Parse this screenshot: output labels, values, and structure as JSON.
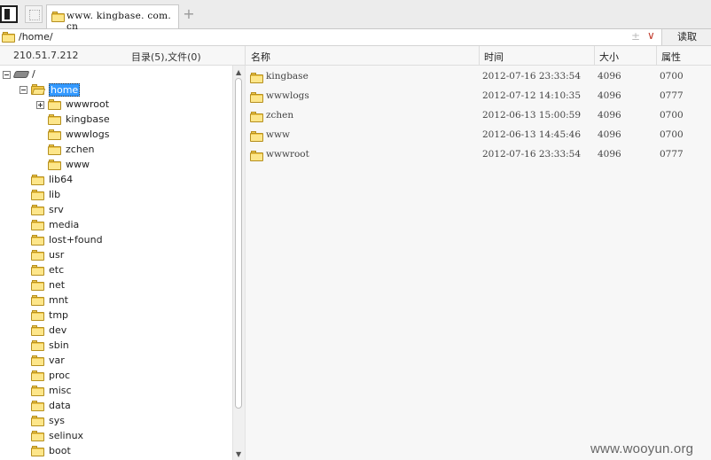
{
  "tabs": [
    {
      "title": "www. kingbase. com. cn"
    }
  ],
  "address": {
    "path": "/home/",
    "read_button": "读取"
  },
  "info": {
    "ip": "210.51.7.212",
    "counts": "目录(5),文件(0)"
  },
  "columns": {
    "name": "名称",
    "time": "时间",
    "size": "大小",
    "perm": "属性"
  },
  "tree": [
    {
      "label": "/",
      "icon": "drive-icon",
      "expander": "minus"
    },
    {
      "label": "home",
      "icon": "folder-open-icon",
      "expander": "minus",
      "selected": true
    },
    {
      "label": "wwwroot",
      "icon": "folder-icon",
      "expander": "plus"
    },
    {
      "label": "kingbase",
      "icon": "folder-icon"
    },
    {
      "label": "wwwlogs",
      "icon": "folder-icon"
    },
    {
      "label": "zchen",
      "icon": "folder-icon"
    },
    {
      "label": "www",
      "icon": "folder-icon"
    },
    {
      "label": "lib64",
      "icon": "folder-icon"
    },
    {
      "label": "lib",
      "icon": "folder-icon"
    },
    {
      "label": "srv",
      "icon": "folder-icon"
    },
    {
      "label": "media",
      "icon": "folder-icon"
    },
    {
      "label": "lost+found",
      "icon": "folder-icon"
    },
    {
      "label": "usr",
      "icon": "folder-icon"
    },
    {
      "label": "etc",
      "icon": "folder-icon"
    },
    {
      "label": "net",
      "icon": "folder-icon"
    },
    {
      "label": "mnt",
      "icon": "folder-icon"
    },
    {
      "label": "tmp",
      "icon": "folder-icon"
    },
    {
      "label": "dev",
      "icon": "folder-icon"
    },
    {
      "label": "sbin",
      "icon": "folder-icon"
    },
    {
      "label": "var",
      "icon": "folder-icon"
    },
    {
      "label": "proc",
      "icon": "folder-icon"
    },
    {
      "label": "misc",
      "icon": "folder-icon"
    },
    {
      "label": "data",
      "icon": "folder-icon"
    },
    {
      "label": "sys",
      "icon": "folder-icon"
    },
    {
      "label": "selinux",
      "icon": "folder-icon"
    },
    {
      "label": "boot",
      "icon": "folder-icon"
    }
  ],
  "files": [
    {
      "name": "kingbase",
      "time": "2012-07-16 23:33:54",
      "size": "4096",
      "perm": "0700"
    },
    {
      "name": "wwwlogs",
      "time": "2012-07-12 14:10:35",
      "size": "4096",
      "perm": "0777"
    },
    {
      "name": "zchen",
      "time": "2012-06-13 15:00:59",
      "size": "4096",
      "perm": "0700"
    },
    {
      "name": "www",
      "time": "2012-06-13 14:45:46",
      "size": "4096",
      "perm": "0700"
    },
    {
      "name": "wwwroot",
      "time": "2012-07-16 23:33:54",
      "size": "4096",
      "perm": "0777"
    }
  ],
  "watermark": "www.wooyun.org"
}
